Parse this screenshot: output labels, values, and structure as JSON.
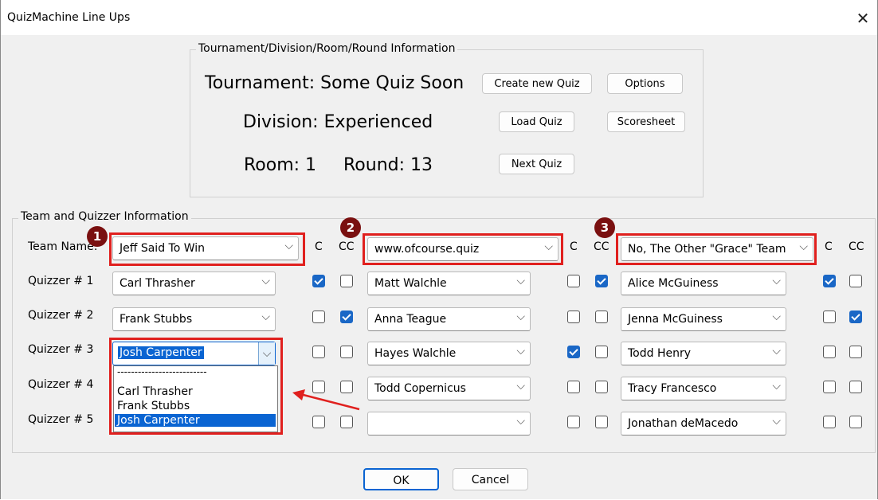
{
  "window": {
    "title": "QuizMachine Line Ups",
    "close_glyph": "✕"
  },
  "tournament_group": {
    "legend": "Tournament/Division/Room/Round Information",
    "tournament": "Tournament: Some Quiz Soon",
    "division": "Division: Experienced",
    "room": "Room: 1",
    "round": "Round: 13",
    "buttons": {
      "create": "Create new Quiz",
      "options": "Options",
      "load": "Load Quiz",
      "scoresheet": "Scoresheet",
      "next": "Next Quiz"
    }
  },
  "team_group": {
    "legend": "Team and Quizzer Information",
    "row_labels": [
      "Team Name:",
      "Quizzer # 1",
      "Quizzer # 2",
      "Quizzer # 3",
      "Quizzer # 4",
      "Quizzer # 5"
    ],
    "c_label": "C",
    "cc_label": "CC",
    "teams": [
      {
        "marker": "1",
        "name": "Jeff Said To Win",
        "quizzers": [
          "Carl Thrasher",
          "Frank Stubbs",
          "Josh Carpenter"
        ],
        "c": [
          true,
          false,
          false,
          false,
          false
        ],
        "cc": [
          false,
          true,
          false,
          false,
          false
        ]
      },
      {
        "marker": "2",
        "name": "www.ofcourse.quiz",
        "quizzers": [
          "Matt Walchle",
          "Anna Teague",
          "Hayes Walchle",
          "Todd Copernicus",
          ""
        ],
        "c": [
          false,
          false,
          true,
          false,
          false
        ],
        "cc": [
          true,
          false,
          false,
          false,
          false
        ]
      },
      {
        "marker": "3",
        "name": "No, The Other \"Grace\" Team",
        "quizzers": [
          "Alice McGuiness",
          "Jenna McGuiness",
          "Todd Henry",
          "Tracy Francesco",
          "Jonathan deMacedo"
        ],
        "c": [
          true,
          false,
          false,
          false,
          false
        ],
        "cc": [
          false,
          true,
          false,
          false,
          false
        ]
      }
    ],
    "dropdown": {
      "separator": "--------------------------",
      "options": [
        "Carl Thrasher",
        "Frank Stubbs",
        "Josh Carpenter"
      ],
      "selected": "Josh Carpenter"
    }
  },
  "footer": {
    "ok": "OK",
    "cancel": "Cancel"
  },
  "colors": {
    "annotation_red": "#e0201e",
    "marker_fill": "#7a1010",
    "checkbox_blue": "#1a67c6",
    "selection_blue": "#0a64d2"
  }
}
